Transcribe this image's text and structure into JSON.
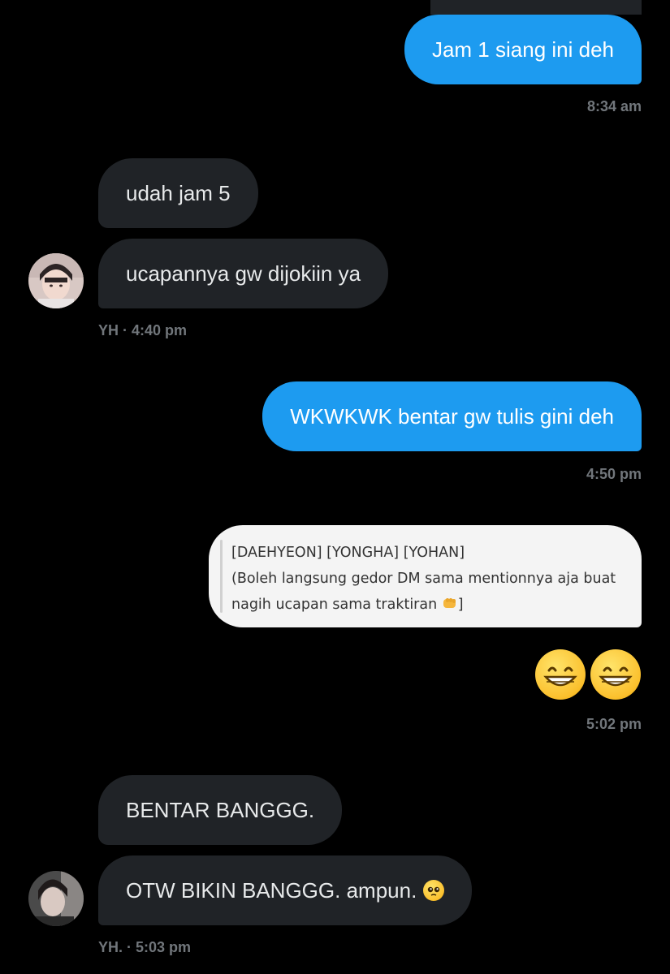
{
  "messages": {
    "m1": {
      "text": "Jam 1 siang ini deh",
      "time": "8:34 am"
    },
    "m2": {
      "text": "udah jam 5"
    },
    "m3": {
      "text": "ucapannya gw dijokiin ya",
      "meta": "YH · 4:40 pm"
    },
    "m4": {
      "text": "WKWKWK bentar gw tulis gini deh",
      "time": "4:50 pm"
    },
    "m5": {
      "line1": "[DAEHYEON] [YONGHA] [YOHAN]",
      "line2": "(Boleh langsung gedor DM sama mentionnya aja buat",
      "line3_prefix": "nagih ucapan sama traktiran ",
      "line3_suffix": "]"
    },
    "m6": {
      "emoji_names": [
        "grinning-face-emoji",
        "grinning-face-emoji"
      ],
      "time": "5:02 pm"
    },
    "m7": {
      "text": "BENTAR BANGGG."
    },
    "m8": {
      "text": "OTW BIKIN BANGGG. ampun.",
      "emoji_name": "pleading-face-emoji",
      "meta": "YH. · 5:03 pm"
    }
  },
  "colors": {
    "outgoing_bubble": "#1d9bf0",
    "incoming_bubble": "#202327",
    "timestamp": "#71767b",
    "background": "#000000"
  }
}
